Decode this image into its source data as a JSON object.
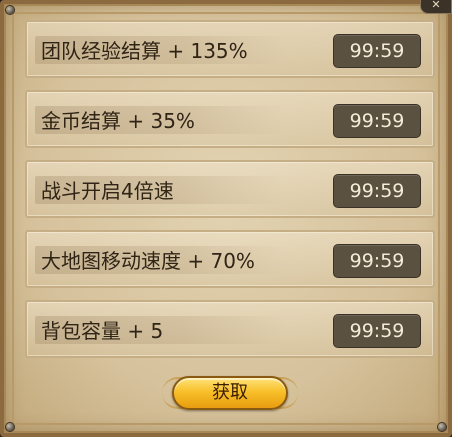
{
  "buffs": [
    {
      "label": "团队经验结算 + 135%",
      "timer": "99:59"
    },
    {
      "label": "金币结算 + 35%",
      "timer": "99:59"
    },
    {
      "label": "战斗开启4倍速",
      "timer": "99:59"
    },
    {
      "label": "大地图移动速度 + 70%",
      "timer": "99:59"
    },
    {
      "label": "背包容量 + 5",
      "timer": "99:59"
    }
  ],
  "obtain_button": {
    "label": "获取"
  },
  "close_icon": "close-icon"
}
